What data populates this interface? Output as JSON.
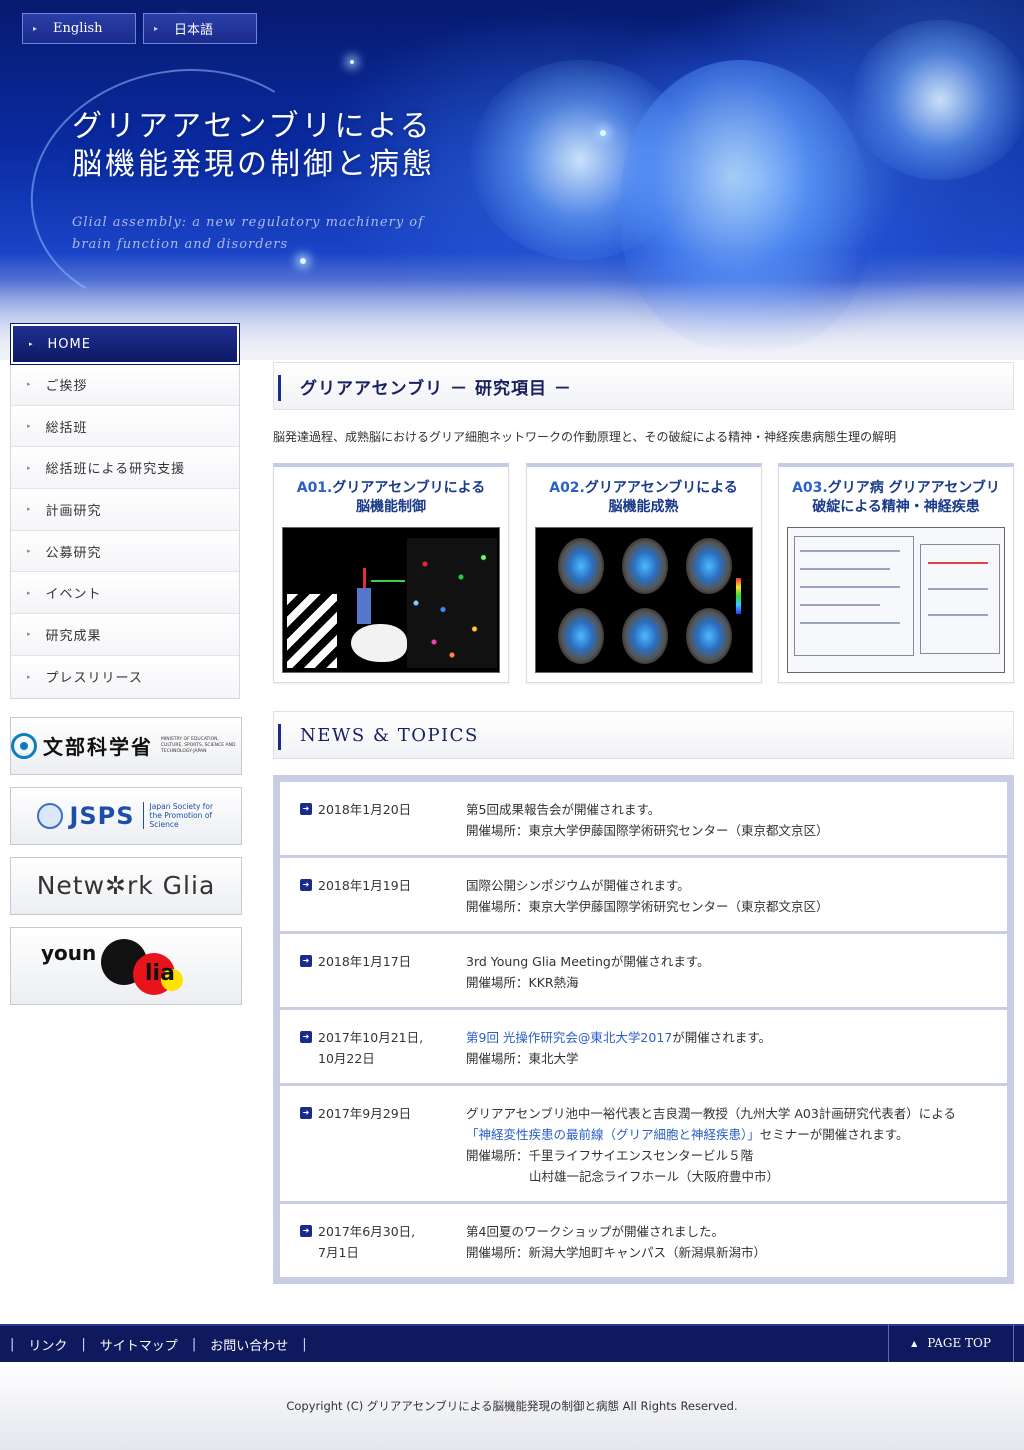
{
  "header": {
    "lang_english": "English",
    "lang_japanese": "日本語",
    "title_line1": "グリアアセンブリによる",
    "title_line2": "脳機能発現の制御と病態",
    "subtitle": "Glial assembly: a new regulatory machinery of brain function and disorders"
  },
  "sidebar": {
    "items": [
      {
        "label": "HOME"
      },
      {
        "label": "ご挨拶"
      },
      {
        "label": "総括班"
      },
      {
        "label": "総括班による研究支援"
      },
      {
        "label": "計画研究"
      },
      {
        "label": "公募研究"
      },
      {
        "label": "イベント"
      },
      {
        "label": "研究成果"
      },
      {
        "label": "プレスリリース"
      }
    ],
    "banners": {
      "mext_text": "文部科学省",
      "mext_sub": "MINISTRY OF EDUCATION, CULTURE, SPORTS, SCIENCE AND TECHNOLOGY-JAPAN",
      "jsps_text": "JSPS",
      "jsps_sub": "Japan Society for the Promotion of Science",
      "network_glia": "Netw✲rk Glia",
      "young_glia_a": "youn",
      "young_glia_b": "lia"
    }
  },
  "research": {
    "heading": "グリアアセンブリ － 研究項目 －",
    "intro": "脳発達過程、成熟脳におけるグリア細胞ネットワークの作動原理と、その破綻による精神・神経疾患病態生理の解明",
    "cards": [
      {
        "code": "A01.",
        "title_a": "グリアアセンブリによる",
        "title_b": "脳機能制御"
      },
      {
        "code": "A02.",
        "title_a": "グリアアセンブリによる",
        "title_b": "脳機能成熟"
      },
      {
        "code": "A03.",
        "title_a": "グリア病 グリアアセンブリ",
        "title_b": "破綻による精神・神経疾患"
      }
    ]
  },
  "news": {
    "heading": "NEWS & TOPICS",
    "items": [
      {
        "date_a": "2018年1月20日",
        "date_b": "",
        "line1": "第5回成果報告会が開催されます。",
        "line2": "開催場所：東京大学伊藤国際学術研究センター（東京都文京区）"
      },
      {
        "date_a": "2018年1月19日",
        "date_b": "",
        "line1": "国際公開シンポジウムが開催されます。",
        "line2": "開催場所：東京大学伊藤国際学術研究センター（東京都文京区）"
      },
      {
        "date_a": "2018年1月17日",
        "date_b": "",
        "line1": "3rd Young Glia Meetingが開催されます。",
        "line2": "開催場所：KKR熱海"
      },
      {
        "date_a": "2017年10月21日,",
        "date_b": "10月22日",
        "line1_link": "第9回 光操作研究会@東北大学2017",
        "line1_rest": "が開催されます。",
        "line2": "開催場所：東北大学"
      },
      {
        "date_a": "2017年9月29日",
        "date_b": "",
        "line1": "グリアアセンブリ池中一裕代表と吉良潤一教授（九州大学 A03計画研究代表者）による",
        "line2_link": "「神経変性疾患の最前線（グリア細胞と神経疾患）」",
        "line2_rest": "セミナーが開催されます。",
        "line3": "開催場所：千里ライフサイエンスセンタービル５階",
        "line4": "山村雄一記念ライフホール（大阪府豊中市）"
      },
      {
        "date_a": "2017年6月30日,",
        "date_b": "7月1日",
        "line1": "第4回夏のワークショップが開催されました。",
        "line2": "開催場所：新潟大学旭町キャンパス（新潟県新潟市）"
      }
    ]
  },
  "footer": {
    "link_links": "リンク",
    "link_sitemap": "サイトマップ",
    "link_contact": "お問い合わせ",
    "separator": "|",
    "page_top": "PAGE TOP",
    "copyright": "Copyright (C) グリアアセンブリによる脳機能発現の制御と病態 All Rights Reserved."
  }
}
